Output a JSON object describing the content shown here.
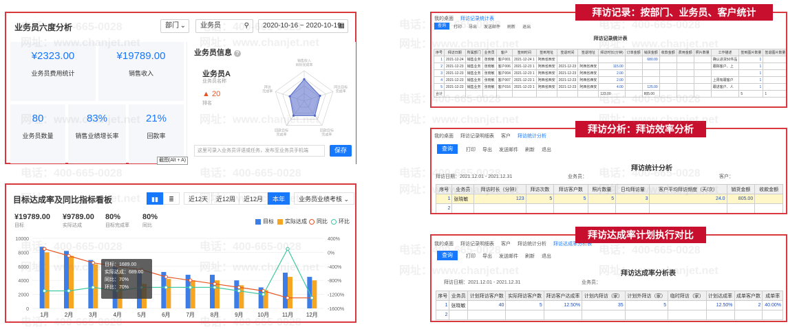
{
  "watermark": {
    "phone": "电话：400-665-0028",
    "site": "网址：www.chanjet.net"
  },
  "panel1": {
    "title": "业务员六度分析",
    "dept_label": "部门",
    "salesman_label": "业务员",
    "date_range": "2020-10-16 ~ 2020-10-19",
    "kpis": [
      {
        "value": "¥2323.00",
        "label": "业务员费用统计"
      },
      {
        "value": "¥19789.00",
        "label": "销售收入"
      },
      {
        "value": "80",
        "label": "业务员数量"
      },
      {
        "value": "83%",
        "label": "销售业绩增长率"
      },
      {
        "value": "21%",
        "label": "回款率"
      }
    ],
    "info": {
      "title": "业务员信息",
      "name": "业务员A",
      "name_sub": "业务员名称",
      "rank": "20",
      "rank_label": "排名",
      "radar_axes": [
        "销售收入\n目标完成率",
        "同比目标\n完成率",
        "回款目标\n完成率",
        "回款目标\n完成率",
        "拜访\n完成率"
      ],
      "radar_values": [
        0.72,
        0.55,
        0.6,
        0.6,
        0.5
      ],
      "note_placeholder": "这里可录入业务员评语或任务，发布至业务员手机端",
      "save": "保存",
      "tooltip": "截图(Alt + A)"
    }
  },
  "panel2": {
    "title": "目标达成率及同比指标看板",
    "tabs": [
      "近12天",
      "近12周",
      "近12月",
      "本年"
    ],
    "active_tab": "本年",
    "select": "业务员业绩考核",
    "stats": [
      {
        "value": "¥19789.00",
        "label": "目标"
      },
      {
        "value": "¥9789.00",
        "label": "实际达成"
      },
      {
        "value": "80%",
        "label": "目标完成率"
      },
      {
        "value": "80%",
        "label": "同比"
      }
    ],
    "legend": [
      "目标",
      "实际达成",
      "同比",
      "环比"
    ],
    "tooltip": {
      "title": "5月",
      "lines": [
        "目标：1689.00",
        "实际达成：689.00",
        "同比：70%",
        "环比：70%"
      ]
    }
  },
  "chart_data": {
    "type": "bar",
    "categories": [
      "1月",
      "2月",
      "3月",
      "4月",
      "5月",
      "6月",
      "7月",
      "8月",
      "9月",
      "10月",
      "11月",
      "12月"
    ],
    "ylim_left": [
      0,
      10000
    ],
    "ylim_right": [
      -1600,
      400
    ],
    "left_ticks": [
      "10000",
      "8000",
      "6000",
      "4000",
      "2000",
      "0"
    ],
    "right_ticks": [
      "400%",
      "0%",
      "-400%",
      "-800%",
      "-1200%",
      "-1600%"
    ],
    "series": [
      {
        "name": "目标",
        "type": "bar",
        "values": [
          8800,
          8200,
          6900,
          6000,
          5100,
          5200,
          4800,
          4800,
          4000,
          3000,
          5100,
          4500
        ]
      },
      {
        "name": "实际达成",
        "type": "bar",
        "values": [
          8000,
          7500,
          6300,
          5600,
          3500,
          4200,
          4000,
          4000,
          3300,
          2600,
          4500,
          4000
        ]
      },
      {
        "name": "同比",
        "type": "line",
        "axis": "right",
        "values": [
          100,
          -100,
          -300,
          -400,
          -500,
          -700,
          -800,
          -900,
          -1000,
          -1100,
          -1300,
          -1300
        ]
      },
      {
        "name": "环比",
        "type": "line",
        "axis": "right",
        "values": [
          -1100,
          -1100,
          -1000,
          -1100,
          -1000,
          -1000,
          -1000,
          -1000,
          -1100,
          -1200,
          100,
          -1300
        ]
      }
    ],
    "colors": {
      "目标": "#3d7de8",
      "实际达成": "#f5a623",
      "同比": "#e8541f",
      "环比": "#3fc9a0"
    }
  },
  "shot1": {
    "banner": "拜访记录：按部门、业务员、客户统计",
    "tabs": [
      "我的桌面",
      "拜访记录统计表"
    ],
    "toolbar": [
      "查询",
      "打印",
      "导出",
      "发送邮件",
      "刷新",
      "退出"
    ],
    "title": "拜访记录统计表",
    "headers": [
      "序号",
      "拜访日期",
      "所属部门",
      "业务员",
      "客户",
      "签到时间",
      "签到地址",
      "签退时间",
      "签退地址",
      "拜访时长(分钟)",
      "订单金额",
      "销货金额",
      "收款金额",
      "费用金额",
      "照片数量",
      "工作描述",
      "签到图片数量",
      "签退图片数量"
    ],
    "rows": [
      [
        "1",
        "2021-12-24",
        "销售业务",
        "张晓敏",
        "客户001",
        "2021-12-24 1",
        "阿西省西安",
        "",
        "",
        "",
        "",
        "680.00",
        "",
        "",
        "",
        "确认进货50件品",
        "1",
        ""
      ],
      [
        "2",
        "2021-12-23",
        "销售业务",
        "张晓敏",
        "客户006",
        "2021-12-23 1",
        "阿西省西安",
        "2021-12-23",
        "阿西省西安",
        "115.00",
        "",
        "",
        "",
        "",
        "",
        "跟踪客户、上",
        "1",
        ""
      ],
      [
        "3",
        "2021-12-23",
        "销售业务",
        "张晓敏",
        "客户004",
        "2021-12-23 1",
        "阿西省西安",
        "2021-12-23",
        "阿西省西安",
        "2.00",
        "",
        "",
        "",
        "",
        "",
        "",
        "1",
        ""
      ],
      [
        "4",
        "2021-12-23",
        "销售业务",
        "张晓敏",
        "客户007",
        "2021-12-23 1",
        "阿西省西安",
        "2021-12-23",
        "阿西省西安",
        "2.00",
        "",
        "",
        "",
        "",
        "",
        "上周有跟客户",
        "1",
        ""
      ],
      [
        "5",
        "2021-12-23",
        "销售业务",
        "张晓敏",
        "客户016",
        "2021-12-23 1",
        "阿西省西安",
        "2021-12-23",
        "阿西省西安",
        "4.00",
        "",
        "125.00",
        "",
        "",
        "",
        "跟进客户、人",
        "1",
        ""
      ]
    ],
    "total": [
      "合计",
      "",
      "",
      "",
      "",
      "",
      "",
      "",
      "",
      "123.00",
      "",
      "805.00",
      "",
      "",
      "",
      "",
      "5",
      "1"
    ]
  },
  "shot2": {
    "banner": "拜访分析：拜访效率分析",
    "tabs": [
      "我的桌面",
      "拜访记录明细表",
      "客户",
      "拜访统计分析"
    ],
    "toolbar": [
      "查询",
      "打印",
      "导出",
      "发送邮件",
      "刷新",
      "退出"
    ],
    "title": "拜访统计分析",
    "date_label": "拜访日期：2021.12.01 - 2021.12.31",
    "salesman_label": "业务员：",
    "customer_label": "客户：",
    "headers": [
      "序号",
      "业务员",
      "拜访时长（分钟）",
      "拜访次数",
      "拜访客户数",
      "照片数量",
      "日均拜访量",
      "客户平均拜访频度（天/次）",
      "销货金额",
      "收款金额"
    ],
    "rows": [
      [
        "1",
        "张晓敏",
        "123",
        "5",
        "5",
        "5",
        "3",
        "24.0",
        "805.00",
        ""
      ],
      [
        "2",
        "",
        "",
        "",
        "",
        "",
        "",
        "",
        "",
        ""
      ]
    ]
  },
  "shot3": {
    "banner": "拜访达成率计划执行对比",
    "tabs": [
      "我的桌面",
      "拜访记录明细表",
      "客户",
      "拜访统计分析",
      "拜访达成率分析表"
    ],
    "toolbar": [
      "查询",
      "打印",
      "导出",
      "发送邮件",
      "刷新",
      "退出"
    ],
    "title": "拜访达成率分析表",
    "date_label": "拜访日期：2021.12.01 - 2021.12.31",
    "salesman_label": "业务员：",
    "headers": [
      "序号",
      "业务员",
      "计划拜访客户数",
      "实际拜访客户数",
      "拜访客户达成率",
      "计划内拜访（家）",
      "计划外拜访（家）",
      "临时拜访（家）",
      "计划达成率",
      "成单客户数",
      "成单率"
    ],
    "rows": [
      [
        "1",
        "张晓敏",
        "40",
        "5",
        "12.50%",
        "35",
        "5",
        "",
        "12.50%",
        "2",
        "40.00%"
      ],
      [
        "2",
        "",
        "",
        "",
        "",
        "",
        "",
        "",
        "",
        "",
        ""
      ]
    ]
  }
}
